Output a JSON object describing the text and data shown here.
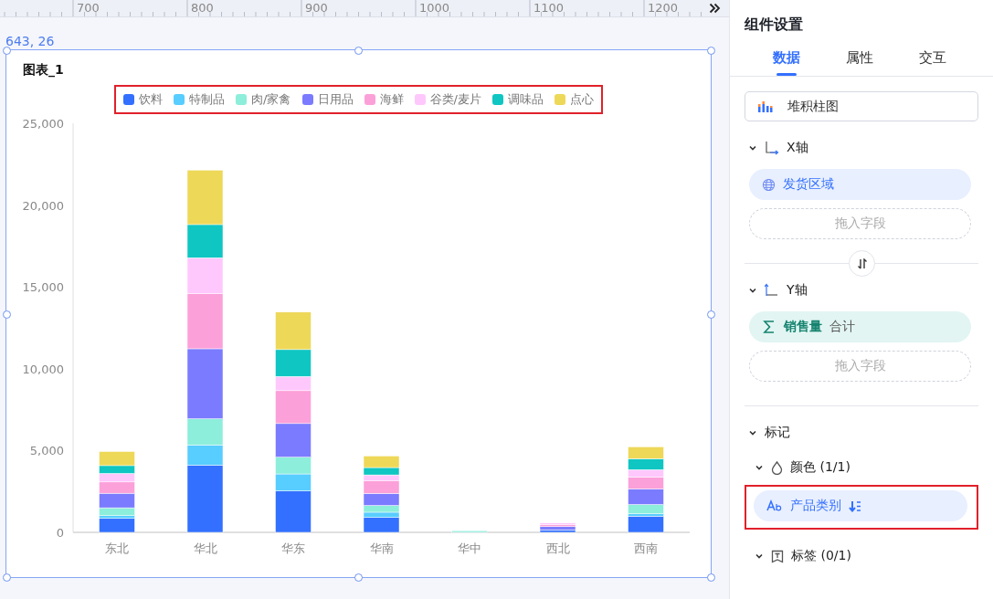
{
  "ruler": {
    "labels": [
      "700",
      "800",
      "900",
      "1000",
      "1100",
      "1200"
    ]
  },
  "canvas": {
    "position": "643, 26"
  },
  "chart": {
    "legend_highlighted": true,
    "chart_data": {
      "type": "bar",
      "stacked": true,
      "title": "图表_1",
      "legend": true,
      "categories": [
        "东北",
        "华北",
        "华东",
        "华南",
        "华中",
        "西北",
        "西南"
      ],
      "ylim": [
        0,
        25000
      ],
      "yticks": [
        {
          "value": 0,
          "label": "0"
        },
        {
          "value": 5000,
          "label": "5,000"
        },
        {
          "value": 10000,
          "label": "10,000"
        },
        {
          "value": 15000,
          "label": "15,000"
        },
        {
          "value": 20000,
          "label": "20,000"
        },
        {
          "value": 25000,
          "label": "25,000"
        }
      ],
      "series": [
        {
          "name": "饮料",
          "color": "#3370ff",
          "values": [
            850,
            4110,
            2530,
            910,
            0,
            150,
            990
          ]
        },
        {
          "name": "特制品",
          "color": "#58cdff",
          "values": [
            170,
            1230,
            1040,
            320,
            0,
            0,
            150
          ]
        },
        {
          "name": "肉/家禽",
          "color": "#8ceedb",
          "values": [
            480,
            1600,
            1020,
            410,
            100,
            0,
            560
          ]
        },
        {
          "name": "日用品",
          "color": "#7b7bff",
          "values": [
            890,
            4280,
            2060,
            740,
            0,
            200,
            950
          ]
        },
        {
          "name": "海鲜",
          "color": "#fca0d9",
          "values": [
            690,
            3370,
            2010,
            760,
            0,
            110,
            730
          ]
        },
        {
          "name": "谷类/麦片",
          "color": "#ffc8fd",
          "values": [
            520,
            2190,
            870,
            370,
            0,
            110,
            450
          ]
        },
        {
          "name": "调味品",
          "color": "#0fc6c2",
          "values": [
            480,
            2030,
            1640,
            450,
            0,
            0,
            670
          ]
        },
        {
          "name": "点心",
          "color": "#eed858",
          "values": [
            860,
            3330,
            2290,
            710,
            0,
            0,
            730
          ]
        }
      ]
    }
  },
  "panel": {
    "title": "组件设置",
    "tabs": [
      {
        "label": "数据",
        "selected": true
      },
      {
        "label": "属性",
        "selected": false
      },
      {
        "label": "交互",
        "selected": false
      }
    ],
    "chart_type": "堆积柱图",
    "axes": [
      {
        "label": "X轴",
        "kind": "x",
        "expanded": true,
        "fields": [
          {
            "kind": "dimension",
            "label": "发货区域"
          }
        ],
        "drop_placeholder": "拖入字段"
      },
      {
        "label": "Y轴",
        "kind": "y",
        "expanded": true,
        "fields": [
          {
            "kind": "measure",
            "label": "销售量",
            "aggregate": "合计"
          }
        ],
        "drop_placeholder": "拖入字段"
      }
    ],
    "marks": {
      "label": "标记",
      "expanded": true,
      "channels": [
        {
          "kind": "color",
          "label": "颜色 (1/1)",
          "expanded": true,
          "fields": [
            {
              "kind": "text",
              "label": "产品类别",
              "highlighted": true
            }
          ]
        },
        {
          "kind": "label",
          "label": "标签 (0/1)",
          "expanded": true
        }
      ]
    }
  }
}
